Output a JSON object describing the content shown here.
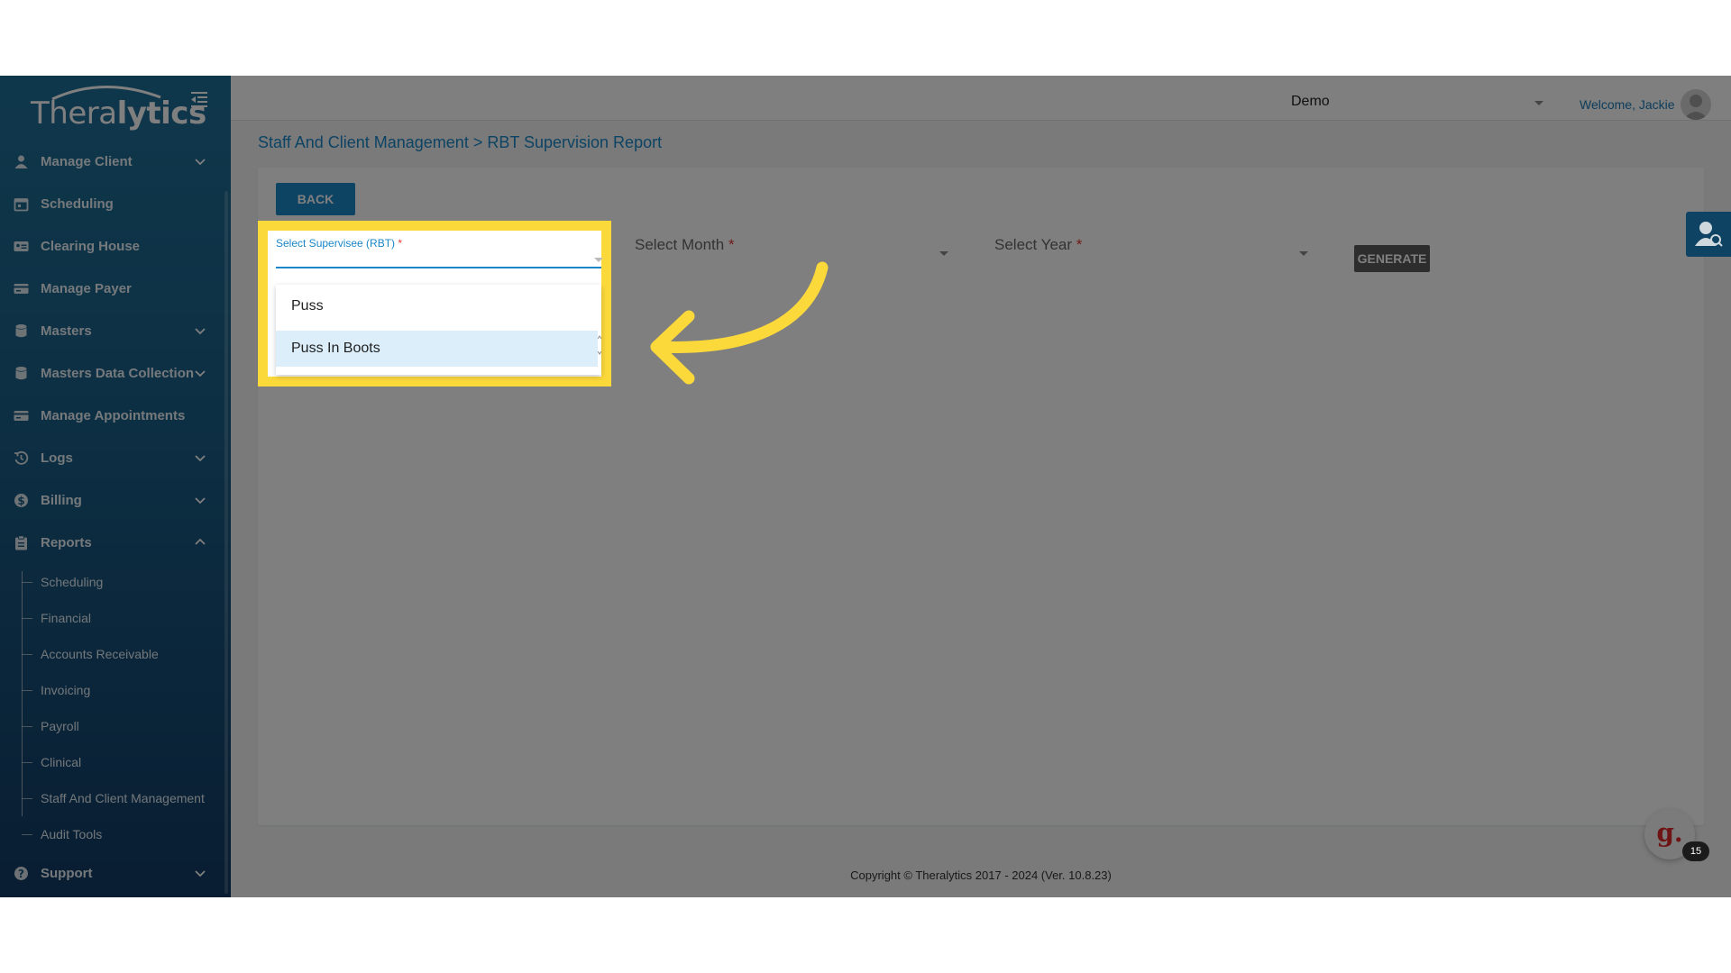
{
  "app": {
    "logo_light": "Thera",
    "logo_bold": "lytics"
  },
  "sidebar": {
    "items": [
      {
        "label": "Manage Client",
        "icon": "person-icon",
        "chevron": "down"
      },
      {
        "label": "Scheduling",
        "icon": "calendar-icon",
        "chevron": ""
      },
      {
        "label": "Clearing House",
        "icon": "id-card-icon",
        "chevron": ""
      },
      {
        "label": "Manage Payer",
        "icon": "card-icon",
        "chevron": ""
      },
      {
        "label": "Masters",
        "icon": "database-icon",
        "chevron": "down"
      },
      {
        "label": "Masters Data Collection",
        "icon": "database-icon",
        "chevron": "down"
      },
      {
        "label": "Manage Appointments",
        "icon": "card-icon",
        "chevron": ""
      },
      {
        "label": "Logs",
        "icon": "history-icon",
        "chevron": "down"
      },
      {
        "label": "Billing",
        "icon": "dollar-icon",
        "chevron": "down"
      },
      {
        "label": "Reports",
        "icon": "clipboard-icon",
        "chevron": "up"
      }
    ],
    "reports_sub": [
      "Scheduling",
      "Financial",
      "Accounts Receivable",
      "Invoicing",
      "Payroll",
      "Clinical",
      "Staff And Client Management",
      "Audit Tools"
    ],
    "support": {
      "label": "Support",
      "icon": "help-icon"
    }
  },
  "header": {
    "org": "Demo",
    "welcome": "Welcome, Jackie"
  },
  "breadcrumb": "Staff And Client Management > RBT Supervision Report",
  "form": {
    "back_label": "BACK",
    "supervisee_label": "Select Supervisee (RBT)",
    "month_label": "Select Month",
    "year_label": "Select Year",
    "required_mark": "*",
    "generate_label": "GENERATE"
  },
  "dropdown": {
    "options": [
      "Puss",
      "Puss In Boots"
    ],
    "active_index": 1
  },
  "footer": "Copyright © Theralytics 2017 - 2024 (Ver. 10.8.23)",
  "widgets": {
    "help_glyph": "g.",
    "badge_count": "15"
  },
  "colors": {
    "accent": "#1a86c7",
    "highlight": "#fcd93b",
    "sidebar_top": "#1f6f97",
    "sidebar_bottom": "#123b64",
    "required": "#e53935"
  }
}
